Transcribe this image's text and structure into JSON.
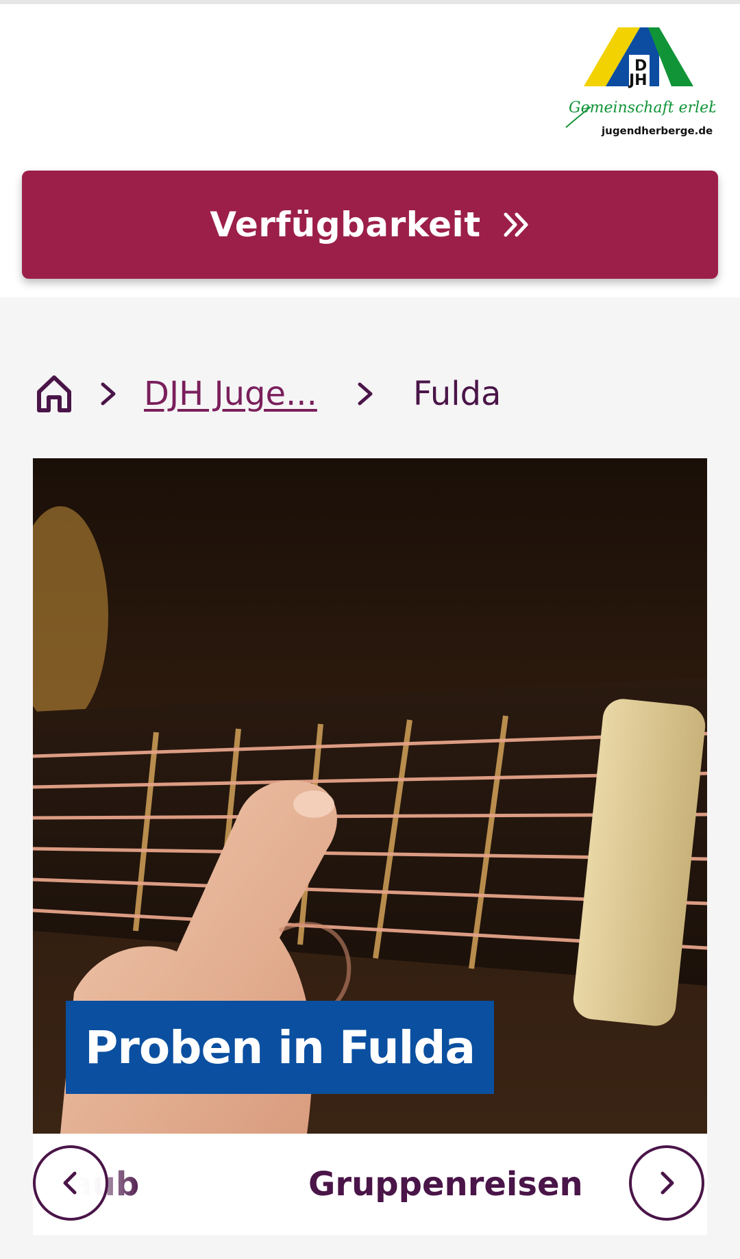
{
  "header": {
    "logo": {
      "letters": "DJH",
      "tagline": "Gemeinschaft erleben",
      "domain": "jugendherberge.de"
    },
    "availability_button": {
      "label": "Verfügbarkeit",
      "icon": "double-chevron-right-icon"
    }
  },
  "breadcrumb": {
    "home_icon": "home-icon",
    "items": [
      {
        "label": "DJH Juge..."
      },
      {
        "label": "Fulda"
      }
    ]
  },
  "hero": {
    "title": "Proben in Fulda"
  },
  "tabs": {
    "items": [
      {
        "label": "urlaub"
      },
      {
        "label": "Gruppenreisen"
      }
    ],
    "prev_icon": "chevron-left-icon",
    "next_icon": "chevron-right-icon"
  },
  "colors": {
    "brand_primary": "#9c1f4a",
    "text_dark": "#4a1548",
    "hero_title_bg": "#0b4fa0",
    "logo_yellow": "#f2d200",
    "logo_blue": "#0c4da2",
    "logo_green": "#119438"
  }
}
